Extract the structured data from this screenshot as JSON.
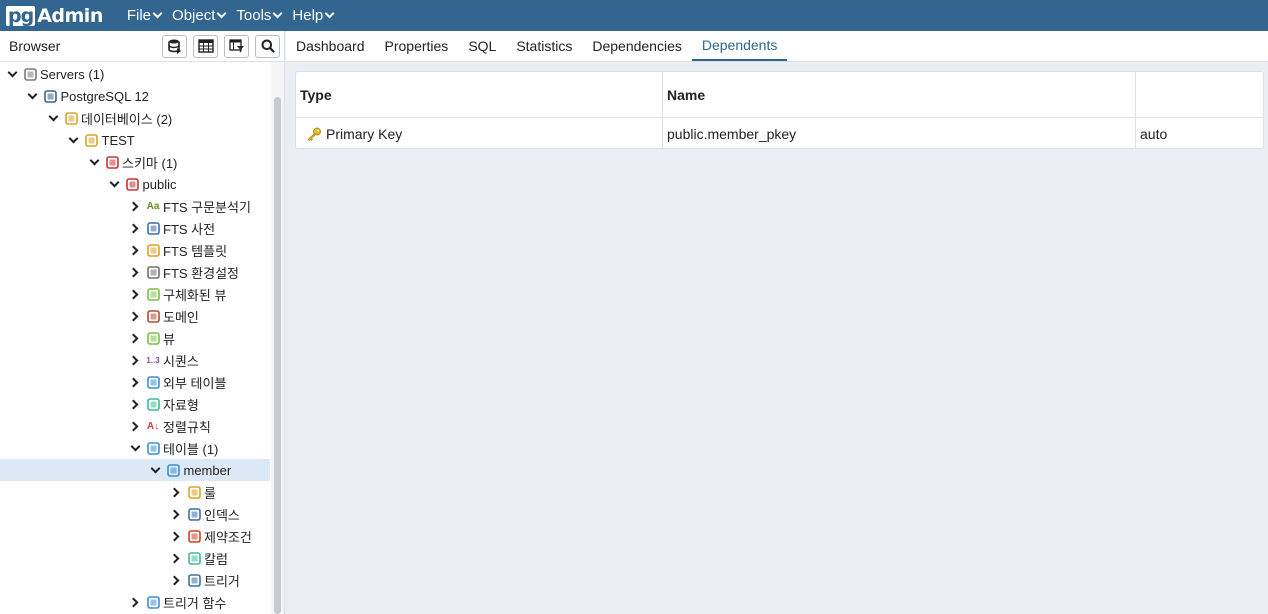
{
  "app": {
    "logo_pg": "pg",
    "logo_admin": "Admin"
  },
  "menu": [
    "File",
    "Object",
    "Tools",
    "Help"
  ],
  "browser": {
    "title": "Browser",
    "toolbar_icons": [
      "database-icon",
      "table-grid-icon",
      "query-filter-icon",
      "search-icon"
    ]
  },
  "tree": [
    {
      "label": "Servers (1)",
      "level": 0,
      "state": "open",
      "icon": "servers-icon",
      "color": "#7a7a7a"
    },
    {
      "label": "PostgreSQL 12",
      "level": 1,
      "state": "open",
      "icon": "postgres-elephant-icon",
      "color": "#336791"
    },
    {
      "label": "데이터베이스 (2)",
      "level": 2,
      "state": "open",
      "icon": "databases-icon",
      "color": "#d4a52a"
    },
    {
      "label": "TEST",
      "level": 3,
      "state": "open",
      "icon": "database-icon",
      "color": "#d4a52a"
    },
    {
      "label": "스키마 (1)",
      "level": 4,
      "state": "open",
      "icon": "schemas-icon",
      "color": "#cc3333"
    },
    {
      "label": "public",
      "level": 5,
      "state": "open",
      "icon": "schema-icon",
      "color": "#cc3333"
    },
    {
      "label": "FTS 구문분석기",
      "level": 6,
      "state": "closed",
      "icon": "fts-parser-icon",
      "color": "#6b8e23"
    },
    {
      "label": "FTS 사전",
      "level": 6,
      "state": "closed",
      "icon": "fts-dictionary-icon",
      "color": "#3c6fa8"
    },
    {
      "label": "FTS 템플릿",
      "level": 6,
      "state": "closed",
      "icon": "fts-template-icon",
      "color": "#e0a020"
    },
    {
      "label": "FTS 환경설정",
      "level": 6,
      "state": "closed",
      "icon": "fts-configuration-icon",
      "color": "#707070"
    },
    {
      "label": "구체화된 뷰",
      "level": 6,
      "state": "closed",
      "icon": "materialized-view-icon",
      "color": "#7ac142"
    },
    {
      "label": "도메인",
      "level": 6,
      "state": "closed",
      "icon": "domain-icon",
      "color": "#b05030"
    },
    {
      "label": "뷰",
      "level": 6,
      "state": "closed",
      "icon": "view-icon",
      "color": "#7ac142"
    },
    {
      "label": "시퀀스",
      "level": 6,
      "state": "closed",
      "icon": "sequence-icon",
      "color": "#8a4fa8"
    },
    {
      "label": "외부 테이블",
      "level": 6,
      "state": "closed",
      "icon": "foreign-table-icon",
      "color": "#3c8fd4"
    },
    {
      "label": "자료형",
      "level": 6,
      "state": "closed",
      "icon": "type-icon",
      "color": "#3cbf8f"
    },
    {
      "label": "정렬규칙",
      "level": 6,
      "state": "closed",
      "icon": "collation-icon",
      "color": "#d04040"
    },
    {
      "label": "테이블 (1)",
      "level": 6,
      "state": "open",
      "icon": "tables-icon",
      "color": "#3c8fd4"
    },
    {
      "label": "member",
      "level": 7,
      "state": "open",
      "icon": "table-icon",
      "color": "#3c8fd4",
      "selected": true
    },
    {
      "label": "룰",
      "level": 8,
      "state": "closed",
      "icon": "rule-icon",
      "color": "#e0a020"
    },
    {
      "label": "인덱스",
      "level": 8,
      "state": "closed",
      "icon": "index-icon",
      "color": "#3c6fa8"
    },
    {
      "label": "제약조건",
      "level": 8,
      "state": "closed",
      "icon": "constraint-icon",
      "color": "#d04020"
    },
    {
      "label": "칼럼",
      "level": 8,
      "state": "closed",
      "icon": "column-icon",
      "color": "#3cbf8f"
    },
    {
      "label": "트리거",
      "level": 8,
      "state": "closed",
      "icon": "trigger-icon",
      "color": "#3c6fa8"
    },
    {
      "label": "트리거 함수",
      "level": 6,
      "state": "closed",
      "icon": "trigger-function-icon",
      "color": "#3c8fd4"
    }
  ],
  "tabs": [
    "Dashboard",
    "Properties",
    "SQL",
    "Statistics",
    "Dependencies",
    "Dependents"
  ],
  "active_tab": "Dependents",
  "grid": {
    "columns": [
      "Type",
      "Name",
      ""
    ],
    "rows": [
      {
        "type": "Primary Key",
        "type_icon": "key-icon",
        "name": "public.member_pkey",
        "restriction": "auto"
      }
    ]
  }
}
